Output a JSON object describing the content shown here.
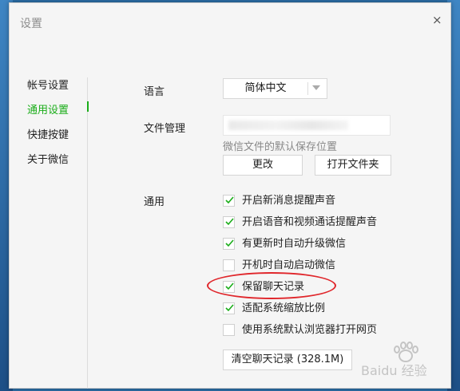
{
  "window": {
    "title": "设置",
    "close_glyph": "×"
  },
  "sidebar": {
    "items": [
      {
        "label": "帐号设置"
      },
      {
        "label": "通用设置",
        "active": true
      },
      {
        "label": "快捷按键"
      },
      {
        "label": "关于微信"
      }
    ]
  },
  "language": {
    "label": "语言",
    "value": "简体中文"
  },
  "files": {
    "label": "文件管理",
    "hint": "微信文件的默认保存位置",
    "change_button": "更改",
    "open_folder_button": "打开文件夹"
  },
  "general": {
    "label": "通用",
    "options": [
      {
        "label": "开启新消息提醒声音",
        "checked": true
      },
      {
        "label": "开启语音和视频通话提醒声音",
        "checked": true
      },
      {
        "label": "有更新时自动升级微信",
        "checked": true
      },
      {
        "label": "开机时自动启动微信",
        "checked": false
      },
      {
        "label": "保留聊天记录",
        "checked": true
      },
      {
        "label": "适配系统缩放比例",
        "checked": true
      },
      {
        "label": "使用系统默认浏览器打开网页",
        "checked": false
      }
    ],
    "clear_button": "清空聊天记录 (328.1M)"
  },
  "watermark": {
    "text": "Baidu 经验"
  },
  "colors": {
    "accent": "#1aad19",
    "annotation": "#e0262b"
  }
}
